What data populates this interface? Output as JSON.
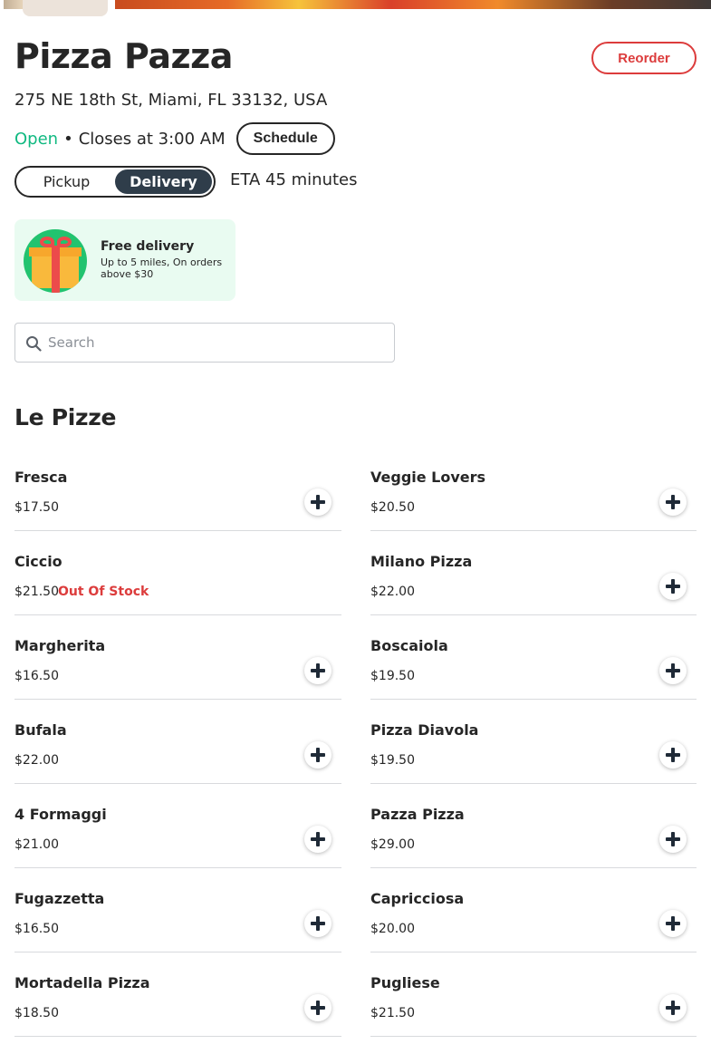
{
  "restaurant": {
    "name": "Pizza Pazza",
    "address": "275 NE 18th St, Miami, FL 33132, USA",
    "open_label": "Open",
    "closes_label": "Closes at 3:00 AM"
  },
  "header": {
    "reorder_label": "Reorder",
    "schedule_label": "Schedule"
  },
  "fulfillment": {
    "options": [
      "Pickup",
      "Delivery"
    ],
    "selected": "Delivery",
    "eta_label": "ETA 45 minutes"
  },
  "promo": {
    "title": "Free delivery",
    "subtitle": "Up to 5 miles, On orders above $30",
    "icon": "gift-icon"
  },
  "search": {
    "placeholder": "Search",
    "value": ""
  },
  "menu": {
    "section_title": "Le Pizze",
    "out_of_stock_label": "Out Of Stock",
    "items": [
      {
        "name": "Fresca",
        "price": "$17.50",
        "out_of_stock": false
      },
      {
        "name": "Veggie Lovers",
        "price": "$20.50",
        "out_of_stock": false
      },
      {
        "name": "Ciccio",
        "price": "$21.50",
        "out_of_stock": true
      },
      {
        "name": "Milano Pizza",
        "price": "$22.00",
        "out_of_stock": false
      },
      {
        "name": "Margherita",
        "price": "$16.50",
        "out_of_stock": false
      },
      {
        "name": "Boscaiola",
        "price": "$19.50",
        "out_of_stock": false
      },
      {
        "name": "Bufala",
        "price": "$22.00",
        "out_of_stock": false
      },
      {
        "name": "Pizza Diavola",
        "price": "$19.50",
        "out_of_stock": false
      },
      {
        "name": "4 Formaggi",
        "price": "$21.00",
        "out_of_stock": false
      },
      {
        "name": "Pazza Pizza",
        "price": "$29.00",
        "out_of_stock": false
      },
      {
        "name": "Fugazzetta",
        "price": "$16.50",
        "out_of_stock": false
      },
      {
        "name": "Capricciosa",
        "price": "$20.00",
        "out_of_stock": false
      },
      {
        "name": "Mortadella Pizza",
        "price": "$18.50",
        "out_of_stock": false
      },
      {
        "name": "Pugliese",
        "price": "$21.50",
        "out_of_stock": false
      }
    ]
  },
  "colors": {
    "accent_red": "#dc3c3c",
    "open_green": "#10b981",
    "toggle_active": "#2f3d4a",
    "promo_bg": "#e9fbf1"
  }
}
